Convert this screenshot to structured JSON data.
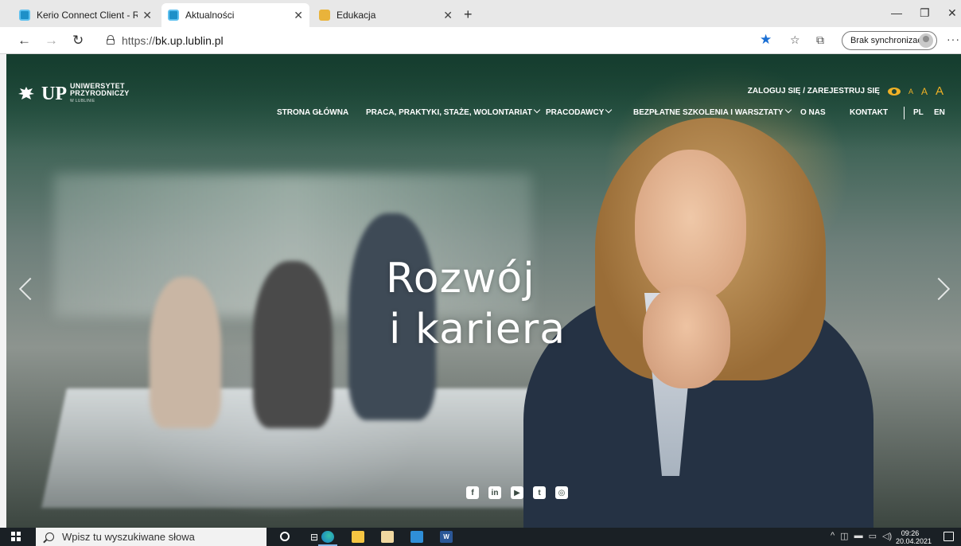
{
  "browser": {
    "tabs": [
      {
        "title": "Kerio Connect Client - Re: Udział",
        "icon": "kerio-icon",
        "active": false
      },
      {
        "title": "Aktualności",
        "icon": "kerio-icon",
        "active": true
      },
      {
        "title": "Edukacja",
        "icon": "up-icon",
        "active": false
      }
    ],
    "new_tab": "+",
    "url_prefix": "https://",
    "url_host": "bk.up.lublin.pl",
    "sync_label": "Brak synchronizacji",
    "more_label": "···"
  },
  "site": {
    "logo": {
      "line1": "UNIWERSYTET",
      "line2": "PRZYRODNICZY",
      "line3": "W LUBLINIE"
    },
    "login": "ZALOGUJ SIĘ / ZAREJESTRUJ SIĘ",
    "font_sizes": [
      "A",
      "A",
      "A"
    ],
    "nav": [
      {
        "label": "STRONA GŁÓWNA",
        "dropdown": false
      },
      {
        "label": "PRACA, PRAKTYKI, STAŻE, WOLONTARIAT",
        "dropdown": true
      },
      {
        "label": "PRACODAWCY",
        "dropdown": true
      },
      {
        "label": "BEZPŁATNE SZKOLENIA I WARSZTATY",
        "dropdown": true
      },
      {
        "label": "O NAS",
        "dropdown": false
      },
      {
        "label": "KONTAKT",
        "dropdown": false
      }
    ],
    "languages": [
      "PL",
      "EN"
    ],
    "headline_line1": "Rozwój",
    "headline_line2": "i kariera",
    "socials": [
      "facebook-icon",
      "linkedin-icon",
      "youtube-icon",
      "twitter-icon",
      "instagram-icon"
    ]
  },
  "taskbar": {
    "search_placeholder": "Wpisz tu wyszukiwane słowa",
    "time": "09:26",
    "date": "20.04.2021"
  },
  "colors": {
    "accent": "#f0b126",
    "star": "#1a6fd4",
    "taskbar": "#1a2025"
  }
}
